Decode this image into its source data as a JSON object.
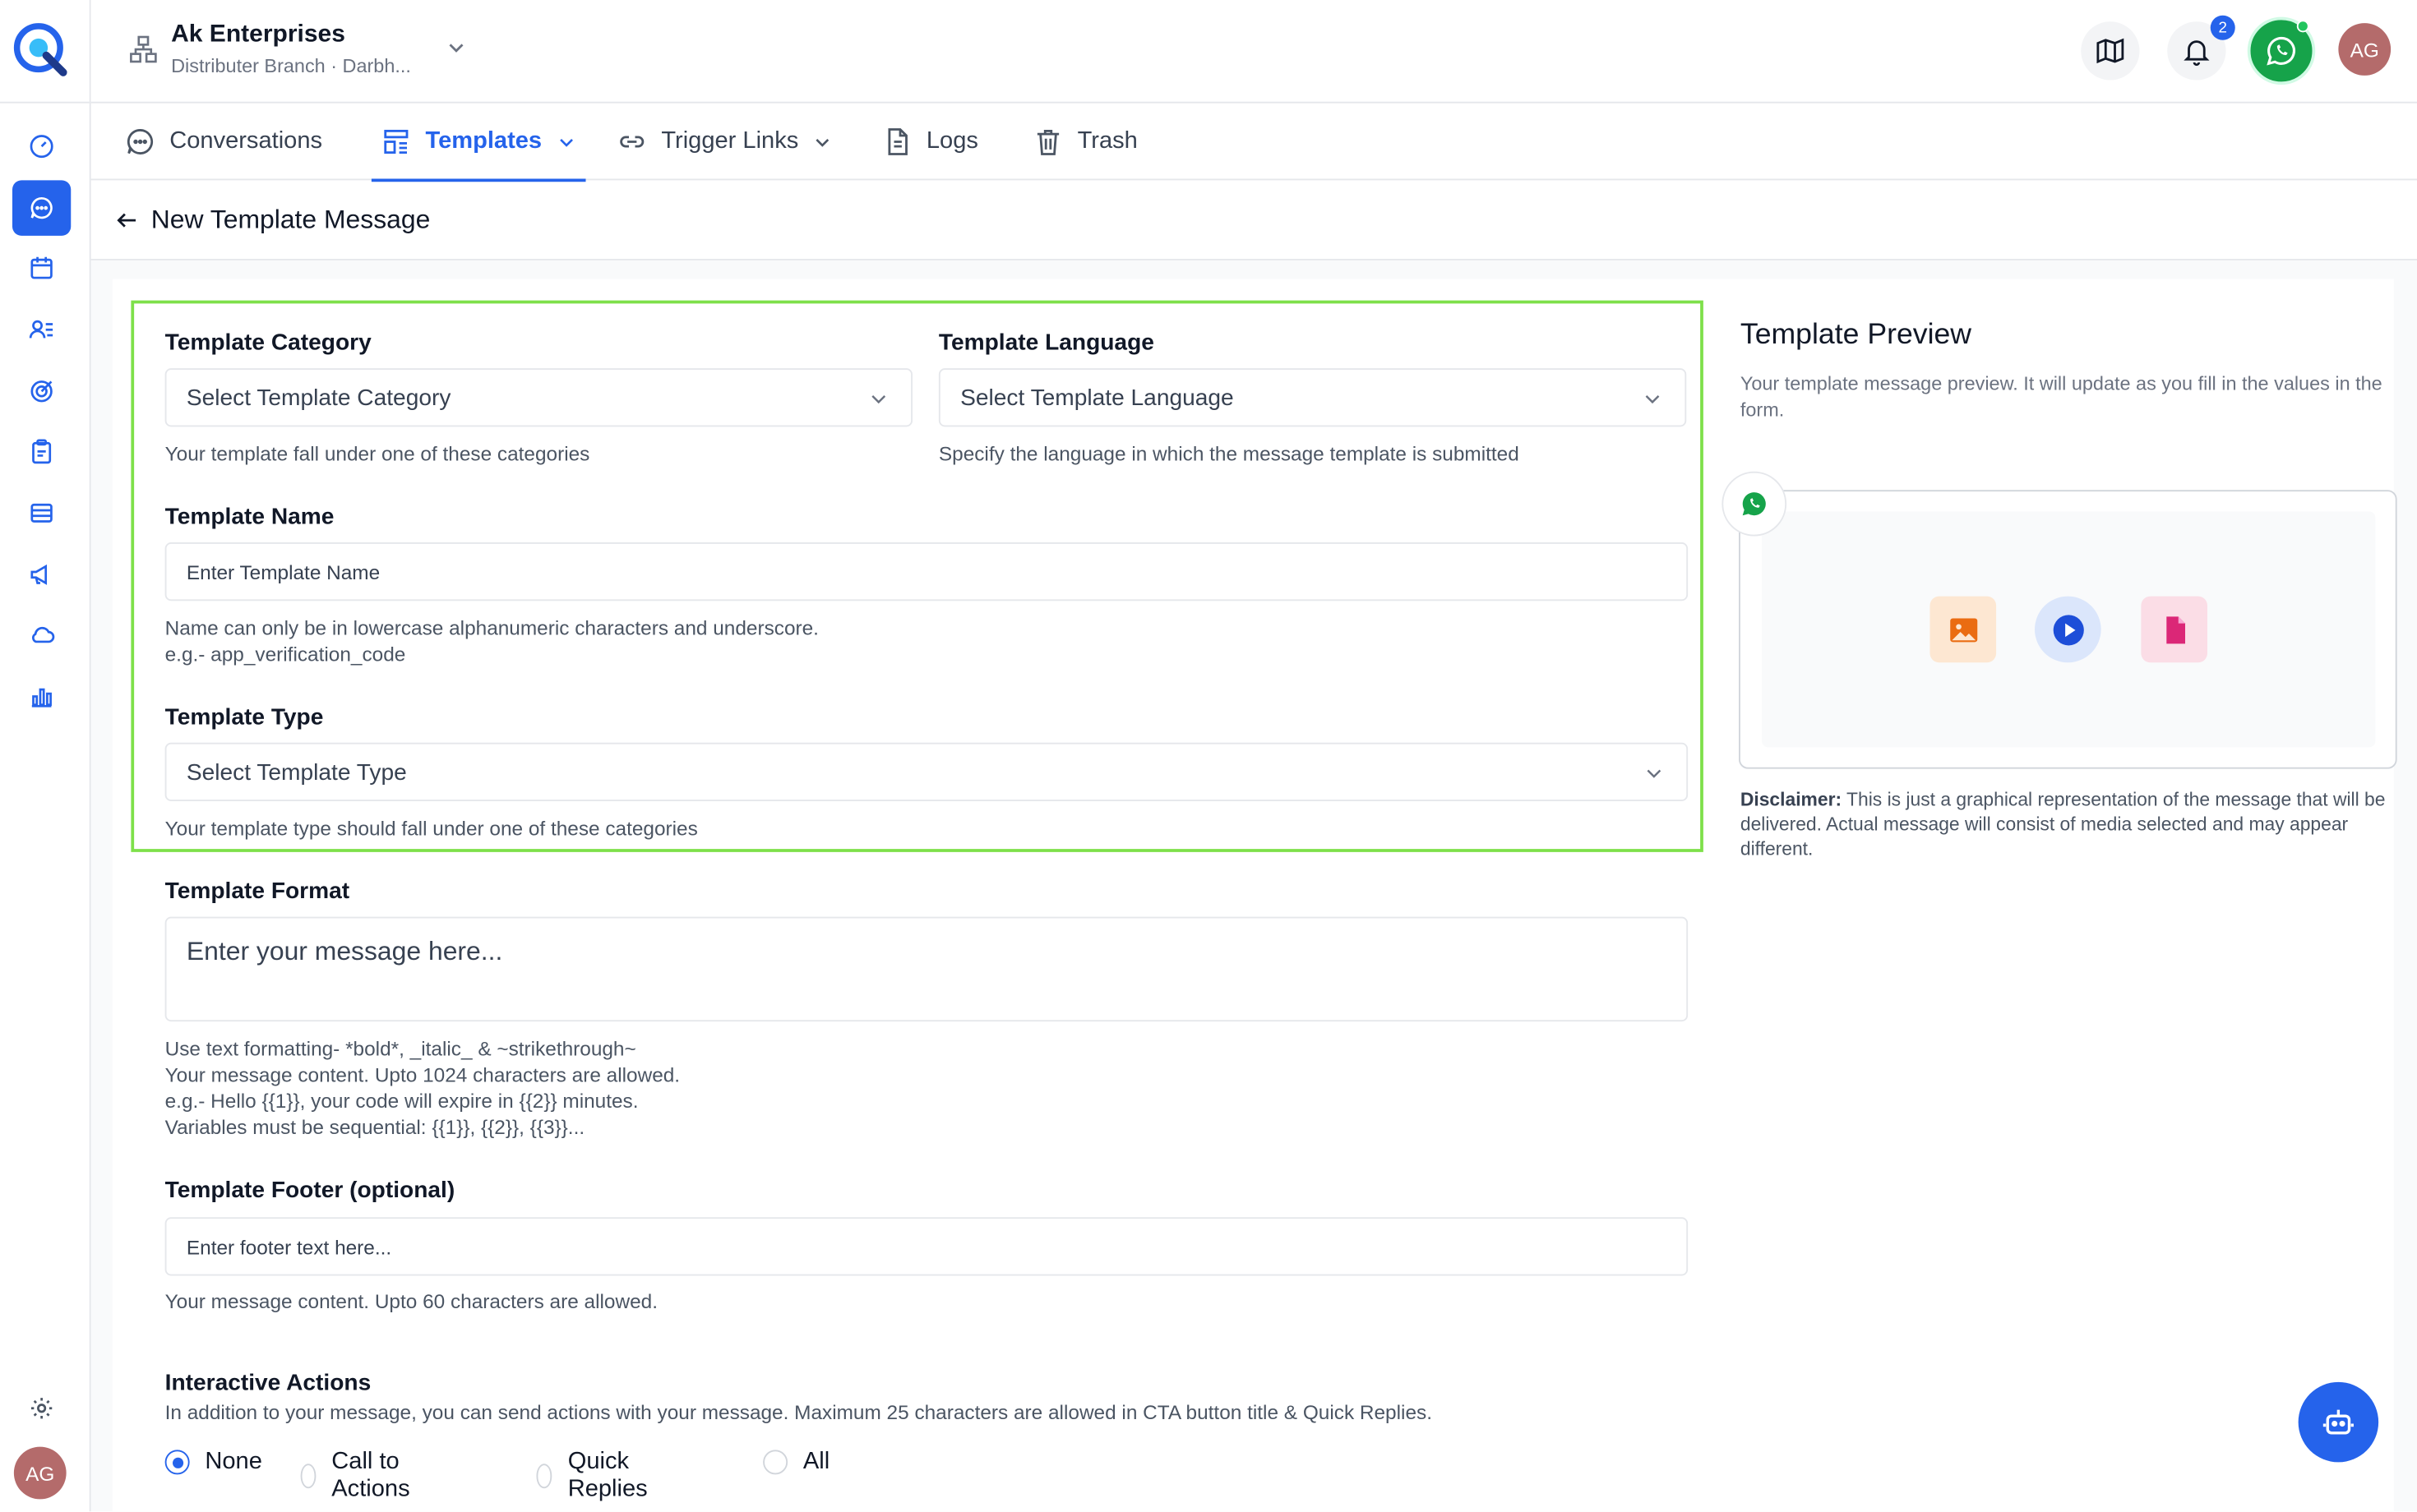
{
  "header": {
    "org_name": "Ak Enterprises",
    "org_sub": "Distributer Branch · Darbh...",
    "notifications_count": "2",
    "avatar_initials": "AG"
  },
  "sidebar": {
    "items": [
      {
        "name": "dashboard",
        "icon": "gauge-icon"
      },
      {
        "name": "conversations",
        "icon": "chat-icon",
        "active": true
      },
      {
        "name": "calendar",
        "icon": "calendar-icon"
      },
      {
        "name": "contacts",
        "icon": "contacts-icon"
      },
      {
        "name": "targets",
        "icon": "target-icon"
      },
      {
        "name": "tasks",
        "icon": "clipboard-icon"
      },
      {
        "name": "layout",
        "icon": "layout-icon"
      },
      {
        "name": "campaigns",
        "icon": "megaphone-icon"
      },
      {
        "name": "cloud",
        "icon": "cloud-icon"
      },
      {
        "name": "reports",
        "icon": "bar-chart-icon"
      }
    ],
    "avatar_initials": "AG"
  },
  "tabs": [
    {
      "label": "Conversations"
    },
    {
      "label": "Templates",
      "active": true
    },
    {
      "label": "Trigger Links"
    },
    {
      "label": "Logs"
    },
    {
      "label": "Trash"
    }
  ],
  "page": {
    "title": "New Template Message"
  },
  "form": {
    "category": {
      "label": "Template Category",
      "placeholder": "Select Template Category",
      "help": "Your template fall under one of these categories"
    },
    "language": {
      "label": "Template Language",
      "placeholder": "Select Template Language",
      "help": "Specify the language in which the message template is submitted"
    },
    "name": {
      "label": "Template Name",
      "placeholder": "Enter Template Name",
      "help1": "Name can only be in lowercase alphanumeric characters and underscore.",
      "help2": "e.g.- app_verification_code"
    },
    "type": {
      "label": "Template Type",
      "placeholder": "Select Template Type",
      "help": "Your template type should fall under one of these categories"
    },
    "format": {
      "label": "Template Format",
      "placeholder": "Enter your message here...",
      "help1": "Use text formatting- *bold*, _italic_ & ~strikethrough~",
      "help2": "Your message content. Upto 1024 characters are allowed.",
      "help3": "e.g.- Hello {{1}}, your code will expire in {{2}} minutes.",
      "help4": "Variables must be sequential: {{1}}, {{2}}, {{3}}..."
    },
    "footer": {
      "label": "Template Footer (optional)",
      "placeholder": "Enter footer text here...",
      "help": "Your message content. Upto 60 characters are allowed."
    },
    "actions": {
      "label": "Interactive Actions",
      "help": "In addition to your message, you can send actions with your message. Maximum 25 characters are allowed in CTA button title & Quick Replies.",
      "options": [
        "None",
        "Call to Actions",
        "Quick Replies",
        "All"
      ],
      "selected": "None"
    }
  },
  "preview": {
    "title": "Template Preview",
    "subtitle": "Your template message preview. It will update as you fill in the values in the form.",
    "disclaimer_label": "Disclaimer:",
    "disclaimer_text": "This is just a graphical representation of the message that will be delivered. Actual message will consist of media selected and may appear different."
  },
  "colors": {
    "accent": "#2563eb",
    "highlight": "#7ee04a",
    "whatsapp": "#16a34a"
  }
}
